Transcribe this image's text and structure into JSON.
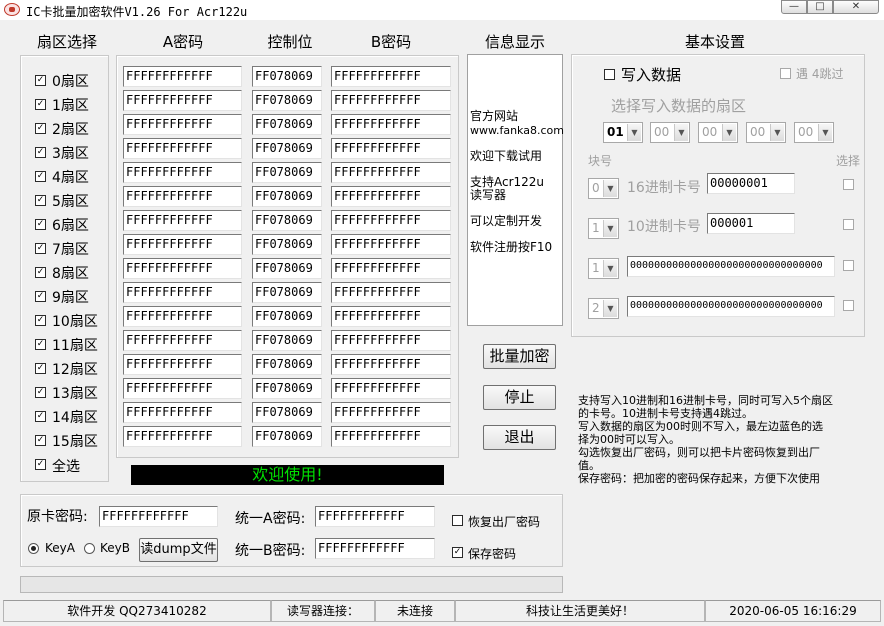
{
  "window": {
    "title": "IC卡批量加密软件V1.26 For Acr122u",
    "min_glyph": "—",
    "max_glyph": "□",
    "close_glyph": "✕"
  },
  "headers": {
    "sector_select": "扇区选择",
    "key_a": "A密码",
    "control": "控制位",
    "key_b": "B密码",
    "info": "信息显示",
    "basic": "基本设置"
  },
  "sectors": [
    {
      "label": "0扇区",
      "key_a": "FFFFFFFFFFFF",
      "control": "FF078069",
      "key_b": "FFFFFFFFFFFF"
    },
    {
      "label": "1扇区",
      "key_a": "FFFFFFFFFFFF",
      "control": "FF078069",
      "key_b": "FFFFFFFFFFFF"
    },
    {
      "label": "2扇区",
      "key_a": "FFFFFFFFFFFF",
      "control": "FF078069",
      "key_b": "FFFFFFFFFFFF"
    },
    {
      "label": "3扇区",
      "key_a": "FFFFFFFFFFFF",
      "control": "FF078069",
      "key_b": "FFFFFFFFFFFF"
    },
    {
      "label": "4扇区",
      "key_a": "FFFFFFFFFFFF",
      "control": "FF078069",
      "key_b": "FFFFFFFFFFFF"
    },
    {
      "label": "5扇区",
      "key_a": "FFFFFFFFFFFF",
      "control": "FF078069",
      "key_b": "FFFFFFFFFFFF"
    },
    {
      "label": "6扇区",
      "key_a": "FFFFFFFFFFFF",
      "control": "FF078069",
      "key_b": "FFFFFFFFFFFF"
    },
    {
      "label": "7扇区",
      "key_a": "FFFFFFFFFFFF",
      "control": "FF078069",
      "key_b": "FFFFFFFFFFFF"
    },
    {
      "label": "8扇区",
      "key_a": "FFFFFFFFFFFF",
      "control": "FF078069",
      "key_b": "FFFFFFFFFFFF"
    },
    {
      "label": "9扇区",
      "key_a": "FFFFFFFFFFFF",
      "control": "FF078069",
      "key_b": "FFFFFFFFFFFF"
    },
    {
      "label": "10扇区",
      "key_a": "FFFFFFFFFFFF",
      "control": "FF078069",
      "key_b": "FFFFFFFFFFFF"
    },
    {
      "label": "11扇区",
      "key_a": "FFFFFFFFFFFF",
      "control": "FF078069",
      "key_b": "FFFFFFFFFFFF"
    },
    {
      "label": "12扇区",
      "key_a": "FFFFFFFFFFFF",
      "control": "FF078069",
      "key_b": "FFFFFFFFFFFF"
    },
    {
      "label": "13扇区",
      "key_a": "FFFFFFFFFFFF",
      "control": "FF078069",
      "key_b": "FFFFFFFFFFFF"
    },
    {
      "label": "14扇区",
      "key_a": "FFFFFFFFFFFF",
      "control": "FF078069",
      "key_b": "FFFFFFFFFFFF"
    },
    {
      "label": "15扇区",
      "key_a": "FFFFFFFFFFFF",
      "control": "FF078069",
      "key_b": "FFFFFFFFFFFF"
    }
  ],
  "select_all": "全选",
  "info_lines": [
    "官方网站",
    "www.fanka8.com",
    "欢迎下载试用",
    "支持Acr122u",
    "读写器",
    "可以定制开发",
    "软件注册按F10"
  ],
  "buttons": {
    "batch_encrypt": "批量加密",
    "stop": "停止",
    "exit": "退出",
    "read_dump": "读dump文件"
  },
  "welcome_banner": "欢迎使用!",
  "basic": {
    "write_data_label": "写入数据",
    "skip_label": "遇 4跳过",
    "select_sector_hint": "选择写入数据的扇区",
    "sector_combos": [
      "01",
      "00",
      "00",
      "00",
      "00"
    ],
    "block_header": "块号",
    "select_header": "选择",
    "rows": [
      {
        "block": "0",
        "label": "16进制卡号",
        "value": "00000001"
      },
      {
        "block": "1",
        "label": "10进制卡号",
        "value": "000001"
      },
      {
        "block": "1",
        "label": "",
        "value": "00000000000000000000000000000000"
      },
      {
        "block": "2",
        "label": "",
        "value": "00000000000000000000000000000000"
      }
    ]
  },
  "help_text": [
    "支持写入10进制和16进制卡号，同时可写入5个扇区",
    "的卡号。10进制卡号支持遇4跳过。",
    "写入数据的扇区为00时则不写入，最左边蓝色的选",
    "择为00时可以写入。",
    "勾选恢复出厂密码，则可以把卡片密码恢复到出厂",
    "值。",
    "保存密码：把加密的密码保存起来，方便下次使用"
  ],
  "keys": {
    "original_label": "原卡密码:",
    "original_value": "FFFFFFFFFFFF",
    "unify_a_label": "统一A密码:",
    "unify_a_value": "FFFFFFFFFFFF",
    "unify_b_label": "统一B密码:",
    "unify_b_value": "FFFFFFFFFFFF",
    "key_a_radio": "KeyA",
    "key_b_radio": "KeyB",
    "restore_factory": "恢复出厂密码",
    "save_password": "保存密码"
  },
  "status": {
    "dev": "软件开发 QQ273410282",
    "reader_label": "读写器连接：",
    "reader_state": "未连接",
    "slogan": "科技让生活更美好！",
    "datetime": "2020-06-05 16:16:29"
  }
}
